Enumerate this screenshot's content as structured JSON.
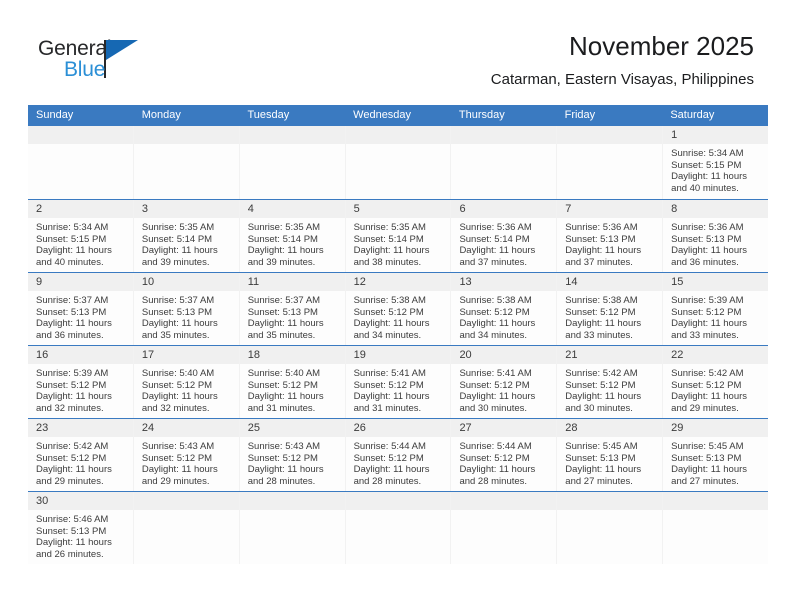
{
  "logo": {
    "word_one": "General",
    "word_two": "Blue",
    "flag_icon": "blue-flag-triangle-icon"
  },
  "header": {
    "title": "November 2025",
    "subtitle": "Catarman, Eastern Visayas, Philippines"
  },
  "colors": {
    "header_blue": "#3a7ac1",
    "logo_blue": "#2b8fd6",
    "logo_dark": "#27282a",
    "day_band_gray": "#f0f0f0",
    "cell_background": "#fdfdfd",
    "text": "#3c3c3c"
  },
  "weekdays": [
    "Sunday",
    "Monday",
    "Tuesday",
    "Wednesday",
    "Thursday",
    "Friday",
    "Saturday"
  ],
  "labels": {
    "sunrise_prefix": "Sunrise:",
    "sunset_prefix": "Sunset:",
    "daylight_prefix": "Daylight:"
  },
  "weeks": [
    [
      {
        "day": "",
        "empty": true
      },
      {
        "day": "",
        "empty": true
      },
      {
        "day": "",
        "empty": true
      },
      {
        "day": "",
        "empty": true
      },
      {
        "day": "",
        "empty": true
      },
      {
        "day": "",
        "empty": true
      },
      {
        "day": "1",
        "sunrise": "Sunrise: 5:34 AM",
        "sunset": "Sunset: 5:15 PM",
        "daylight": "Daylight: 11 hours and 40 minutes."
      }
    ],
    [
      {
        "day": "2",
        "sunrise": "Sunrise: 5:34 AM",
        "sunset": "Sunset: 5:15 PM",
        "daylight": "Daylight: 11 hours and 40 minutes."
      },
      {
        "day": "3",
        "sunrise": "Sunrise: 5:35 AM",
        "sunset": "Sunset: 5:14 PM",
        "daylight": "Daylight: 11 hours and 39 minutes."
      },
      {
        "day": "4",
        "sunrise": "Sunrise: 5:35 AM",
        "sunset": "Sunset: 5:14 PM",
        "daylight": "Daylight: 11 hours and 39 minutes."
      },
      {
        "day": "5",
        "sunrise": "Sunrise: 5:35 AM",
        "sunset": "Sunset: 5:14 PM",
        "daylight": "Daylight: 11 hours and 38 minutes."
      },
      {
        "day": "6",
        "sunrise": "Sunrise: 5:36 AM",
        "sunset": "Sunset: 5:14 PM",
        "daylight": "Daylight: 11 hours and 37 minutes."
      },
      {
        "day": "7",
        "sunrise": "Sunrise: 5:36 AM",
        "sunset": "Sunset: 5:13 PM",
        "daylight": "Daylight: 11 hours and 37 minutes."
      },
      {
        "day": "8",
        "sunrise": "Sunrise: 5:36 AM",
        "sunset": "Sunset: 5:13 PM",
        "daylight": "Daylight: 11 hours and 36 minutes."
      }
    ],
    [
      {
        "day": "9",
        "sunrise": "Sunrise: 5:37 AM",
        "sunset": "Sunset: 5:13 PM",
        "daylight": "Daylight: 11 hours and 36 minutes."
      },
      {
        "day": "10",
        "sunrise": "Sunrise: 5:37 AM",
        "sunset": "Sunset: 5:13 PM",
        "daylight": "Daylight: 11 hours and 35 minutes."
      },
      {
        "day": "11",
        "sunrise": "Sunrise: 5:37 AM",
        "sunset": "Sunset: 5:13 PM",
        "daylight": "Daylight: 11 hours and 35 minutes."
      },
      {
        "day": "12",
        "sunrise": "Sunrise: 5:38 AM",
        "sunset": "Sunset: 5:12 PM",
        "daylight": "Daylight: 11 hours and 34 minutes."
      },
      {
        "day": "13",
        "sunrise": "Sunrise: 5:38 AM",
        "sunset": "Sunset: 5:12 PM",
        "daylight": "Daylight: 11 hours and 34 minutes."
      },
      {
        "day": "14",
        "sunrise": "Sunrise: 5:38 AM",
        "sunset": "Sunset: 5:12 PM",
        "daylight": "Daylight: 11 hours and 33 minutes."
      },
      {
        "day": "15",
        "sunrise": "Sunrise: 5:39 AM",
        "sunset": "Sunset: 5:12 PM",
        "daylight": "Daylight: 11 hours and 33 minutes."
      }
    ],
    [
      {
        "day": "16",
        "sunrise": "Sunrise: 5:39 AM",
        "sunset": "Sunset: 5:12 PM",
        "daylight": "Daylight: 11 hours and 32 minutes."
      },
      {
        "day": "17",
        "sunrise": "Sunrise: 5:40 AM",
        "sunset": "Sunset: 5:12 PM",
        "daylight": "Daylight: 11 hours and 32 minutes."
      },
      {
        "day": "18",
        "sunrise": "Sunrise: 5:40 AM",
        "sunset": "Sunset: 5:12 PM",
        "daylight": "Daylight: 11 hours and 31 minutes."
      },
      {
        "day": "19",
        "sunrise": "Sunrise: 5:41 AM",
        "sunset": "Sunset: 5:12 PM",
        "daylight": "Daylight: 11 hours and 31 minutes."
      },
      {
        "day": "20",
        "sunrise": "Sunrise: 5:41 AM",
        "sunset": "Sunset: 5:12 PM",
        "daylight": "Daylight: 11 hours and 30 minutes."
      },
      {
        "day": "21",
        "sunrise": "Sunrise: 5:42 AM",
        "sunset": "Sunset: 5:12 PM",
        "daylight": "Daylight: 11 hours and 30 minutes."
      },
      {
        "day": "22",
        "sunrise": "Sunrise: 5:42 AM",
        "sunset": "Sunset: 5:12 PM",
        "daylight": "Daylight: 11 hours and 29 minutes."
      }
    ],
    [
      {
        "day": "23",
        "sunrise": "Sunrise: 5:42 AM",
        "sunset": "Sunset: 5:12 PM",
        "daylight": "Daylight: 11 hours and 29 minutes."
      },
      {
        "day": "24",
        "sunrise": "Sunrise: 5:43 AM",
        "sunset": "Sunset: 5:12 PM",
        "daylight": "Daylight: 11 hours and 29 minutes."
      },
      {
        "day": "25",
        "sunrise": "Sunrise: 5:43 AM",
        "sunset": "Sunset: 5:12 PM",
        "daylight": "Daylight: 11 hours and 28 minutes."
      },
      {
        "day": "26",
        "sunrise": "Sunrise: 5:44 AM",
        "sunset": "Sunset: 5:12 PM",
        "daylight": "Daylight: 11 hours and 28 minutes."
      },
      {
        "day": "27",
        "sunrise": "Sunrise: 5:44 AM",
        "sunset": "Sunset: 5:12 PM",
        "daylight": "Daylight: 11 hours and 28 minutes."
      },
      {
        "day": "28",
        "sunrise": "Sunrise: 5:45 AM",
        "sunset": "Sunset: 5:13 PM",
        "daylight": "Daylight: 11 hours and 27 minutes."
      },
      {
        "day": "29",
        "sunrise": "Sunrise: 5:45 AM",
        "sunset": "Sunset: 5:13 PM",
        "daylight": "Daylight: 11 hours and 27 minutes."
      }
    ],
    [
      {
        "day": "30",
        "sunrise": "Sunrise: 5:46 AM",
        "sunset": "Sunset: 5:13 PM",
        "daylight": "Daylight: 11 hours and 26 minutes."
      },
      {
        "day": "",
        "empty": true
      },
      {
        "day": "",
        "empty": true
      },
      {
        "day": "",
        "empty": true
      },
      {
        "day": "",
        "empty": true
      },
      {
        "day": "",
        "empty": true
      },
      {
        "day": "",
        "empty": true
      }
    ]
  ]
}
